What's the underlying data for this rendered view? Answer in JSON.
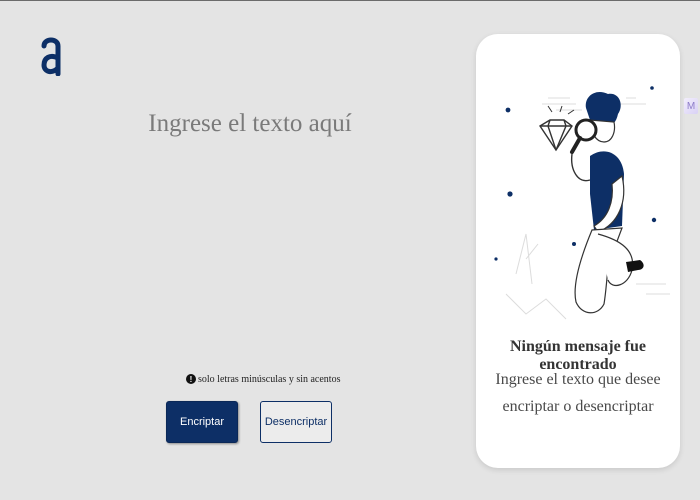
{
  "app": {
    "logo_icon": "alura-logo-icon"
  },
  "editor": {
    "placeholder": "Ingrese el texto aquí"
  },
  "hint": {
    "icon": "info-icon",
    "icon_glyph": "!",
    "text": "solo letras minúsculas y sin acentos"
  },
  "buttons": {
    "encrypt_label": "Encriptar",
    "decrypt_label": "Desencriptar"
  },
  "result_panel": {
    "title": "Ningún mensaje fue encontrado",
    "description": "Ingrese el texto que desee encriptar o desencriptar",
    "illustration": "person-with-magnifying-glass-illustration"
  },
  "browser_extension": {
    "icon": "extension-icon",
    "glyph": "M"
  },
  "colors": {
    "background": "#e4e4e4",
    "accent": "#0d2f66",
    "panel": "#ffffff"
  }
}
